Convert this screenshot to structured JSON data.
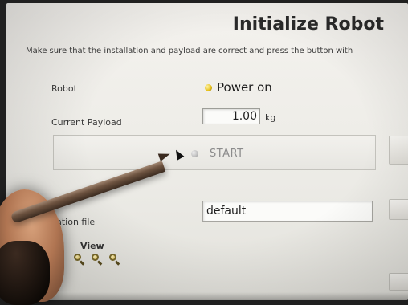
{
  "header": {
    "title": "Initialize Robot",
    "instruction": "Make sure that the installation and payload are correct and press the button with"
  },
  "robot": {
    "label": "Robot",
    "status": "Power on",
    "status_color": "#e8c21c"
  },
  "payload": {
    "label": "Current Payload",
    "value": "1.00",
    "unit": "kg"
  },
  "start": {
    "label": "START",
    "indicator_color": "#bdbdbd"
  },
  "installation": {
    "label": "ilation file",
    "value": "default"
  },
  "view": {
    "label": "View",
    "icons": [
      "zoom-in-icon",
      "zoom-reset-icon",
      "zoom-out-icon"
    ]
  }
}
